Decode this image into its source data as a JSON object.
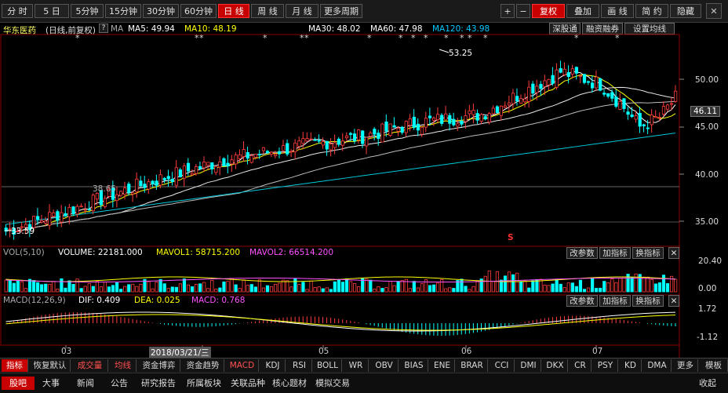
{
  "toolbar": {
    "periods": [
      "分 时",
      "5 日",
      "5分钟",
      "15分钟",
      "30分钟",
      "60分钟",
      "日 线",
      "周 线",
      "月 线",
      "更多周期"
    ],
    "right": [
      "+",
      "−",
      "复权",
      "叠加",
      "画 线",
      "简 约",
      "隐藏"
    ],
    "active_period": "日 线"
  },
  "header": {
    "name": "华东医药",
    "mode": "(日线,前复权)",
    "q": "?",
    "ma": "MA",
    "ma5": "MA5: 49.94",
    "ma10": "MA10: 48.19",
    "ma30": "MA30: 48.02",
    "ma60": "MA60: 47.98",
    "ma120": "MA120: 43.98",
    "btn1": "深股通",
    "btn2": "融资融券",
    "btn3": "设置均线"
  },
  "price_axis": {
    "ticks": [
      "50.00",
      "45.00",
      "40.00",
      "35.00"
    ],
    "last": "46.11"
  },
  "annotations": {
    "high": "53.25",
    "low": "33.59",
    "line_label": "38.65",
    "s_mark": "S"
  },
  "vol": {
    "title": "VOL(5,10)",
    "volume": "VOLUME: 22181.000",
    "mavol1": "MAVOL1: 58715.200",
    "mavol2": "MAVOL2: 66514.200",
    "btns": [
      "改参数",
      "加指标",
      "换指标"
    ],
    "ticks": [
      "20.40",
      "0.00"
    ]
  },
  "macd": {
    "title": "MACD(12,26,9)",
    "dif": "DIF: 0.409",
    "dea": "DEA: 0.025",
    "macd": "MACD: 0.768",
    "btns": [
      "改参数",
      "加指标",
      "换指标"
    ],
    "ticks": [
      "1.72",
      "-1.12"
    ]
  },
  "time_axis": {
    "months": [
      "03",
      "04",
      "05",
      "06",
      "07"
    ],
    "cursor": "2018/03/21/三"
  },
  "indicator_tabs": [
    "指标",
    "恢复默认",
    "成交量",
    "均线",
    "资金博弈",
    "资金趋势",
    "MACD",
    "KDJ",
    "RSI",
    "BOLL",
    "WR",
    "OBV",
    "BIAS",
    "ENE",
    "BRAR",
    "CCI",
    "DMI",
    "DKX",
    "CR",
    "PSY",
    "KD",
    "DMA",
    "更多",
    "模板"
  ],
  "bottom_tabs": [
    "股吧",
    "大事",
    "新闻",
    "公告",
    "研究报告",
    "所属板块",
    "关联品种",
    "核心题材",
    "模拟交易"
  ],
  "bottom_right": "收起",
  "colors": {
    "up": "#ff3c3c",
    "down": "#00ffff",
    "ma5": "#ffffff",
    "ma10": "#ffff00",
    "ma30": "#ff80ff",
    "ma60": "#00ff00",
    "ma120": "#00a0ff",
    "accent": "#c80000"
  }
}
